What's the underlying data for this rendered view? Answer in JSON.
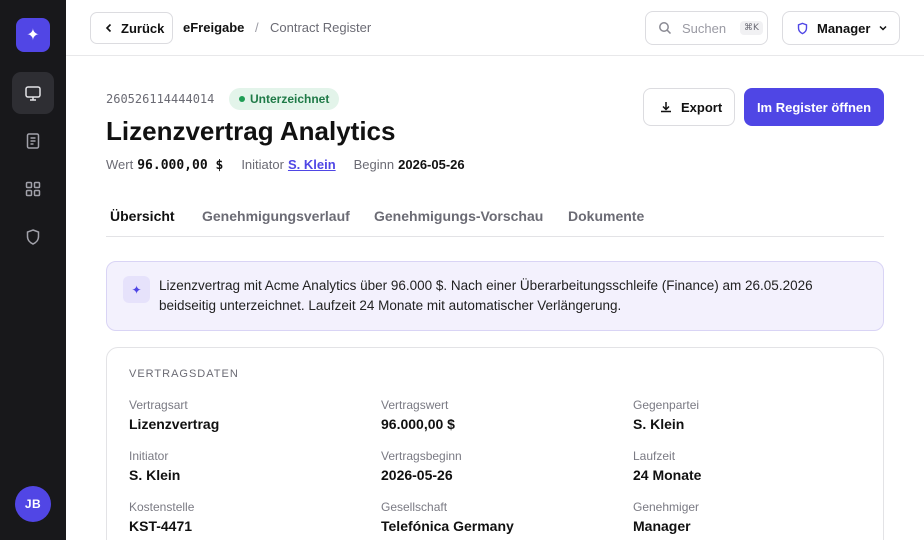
{
  "header": {
    "back_label": "Zurück",
    "app_name": "eFreigabe",
    "separator": "/",
    "page": "Contract Register",
    "search": {
      "placeholder": "Suchen",
      "shortcut": "⌘K"
    },
    "role": "Manager"
  },
  "user": {
    "initials": "JB"
  },
  "sidebar": {
    "logo": "sparkle-icon",
    "items": [
      {
        "icon": "monitor-icon",
        "active": true
      },
      {
        "icon": "document-icon",
        "active": false
      },
      {
        "icon": "grid-icon",
        "active": false
      },
      {
        "icon": "shield-icon",
        "active": false
      }
    ]
  },
  "document": {
    "id": "260526114444014",
    "status": "Unterzeichnet",
    "title": "Lizenzvertrag Analytics",
    "meta": {
      "value_label": "Wert",
      "value": "96.000,00 $",
      "initiator_label": "Initiator",
      "initiator": "S. Klein",
      "start_label": "Beginn",
      "start": "2026-05-26"
    },
    "actions": {
      "export": "Export",
      "open": "Im Register öffnen"
    }
  },
  "tabs": [
    {
      "label": "Übersicht",
      "active": true
    },
    {
      "label": "Genehmigungsverlauf",
      "active": false
    },
    {
      "label": "Genehmigungs-Vorschau",
      "active": false
    },
    {
      "label": "Dokumente",
      "active": false
    }
  ],
  "summary": {
    "text": "Lizenzvertrag mit Acme Analytics über 96.000 $. Nach einer Überarbeitungsschleife (Finance) am 26.05.2026 beidseitig unterzeichnet. Laufzeit 24 Monate mit automatischer Verlängerung."
  },
  "contract_card": {
    "title": "VERTRAGSDATEN",
    "fields": [
      {
        "label": "Vertragsart",
        "value": "Lizenzvertrag"
      },
      {
        "label": "Vertragswert",
        "value": "96.000,00 $"
      },
      {
        "label": "Gegenpartei",
        "value": "S. Klein"
      },
      {
        "label": "Initiator",
        "value": "S. Klein"
      },
      {
        "label": "Vertragsbeginn",
        "value": "2026-05-26"
      },
      {
        "label": "Laufzeit",
        "value": "24 Monate"
      },
      {
        "label": "Kostenstelle",
        "value": "KST-4471"
      },
      {
        "label": "Gesellschaft",
        "value": "Telefónica Germany"
      },
      {
        "label": "Genehmiger",
        "value": "Manager"
      }
    ]
  },
  "colors": {
    "accent": "#4f46e5",
    "sidebar": "#18181b",
    "success": "#1f7a47"
  }
}
